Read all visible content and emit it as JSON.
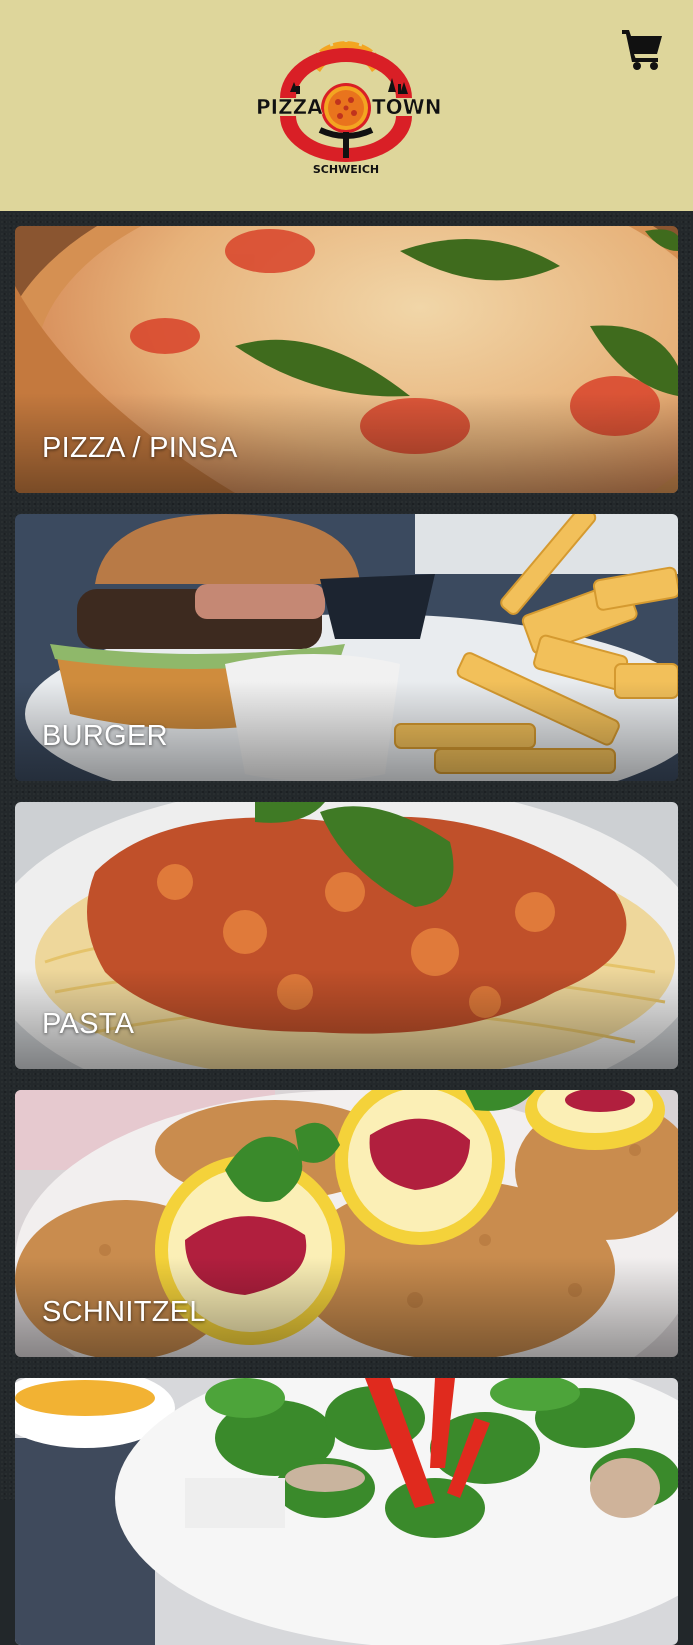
{
  "header": {
    "logo": {
      "line1_left": "PIZZA",
      "line1_right": "TOWN",
      "line2": "SCHWEICH"
    },
    "cart_icon": "shopping-cart-icon"
  },
  "categories": [
    {
      "label": "PIZZA / PINSA"
    },
    {
      "label": "BURGER"
    },
    {
      "label": "PASTA"
    },
    {
      "label": "SCHNITZEL"
    },
    {
      "label": ""
    }
  ],
  "colors": {
    "header_bg": "#ded69b",
    "page_bg": "#23282b",
    "logo_orange": "#f3a521",
    "logo_red": "#d91f26"
  }
}
